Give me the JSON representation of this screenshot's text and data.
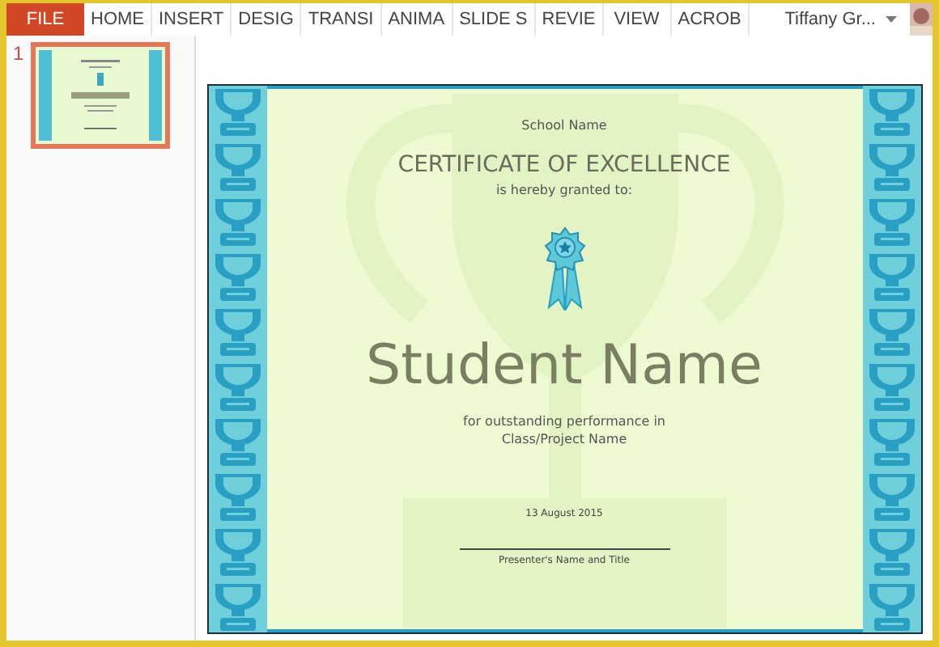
{
  "ribbon": {
    "tabs": [
      {
        "label": "FILE",
        "kind": "file"
      },
      {
        "label": "HOME",
        "kind": "tab"
      },
      {
        "label": "INSERT",
        "kind": "tab"
      },
      {
        "label": "DESIG",
        "kind": "tab"
      },
      {
        "label": "TRANSI",
        "kind": "tab"
      },
      {
        "label": "ANIMA",
        "kind": "tab"
      },
      {
        "label": "SLIDE S",
        "kind": "tab"
      },
      {
        "label": "REVIE",
        "kind": "tab"
      },
      {
        "label": "VIEW",
        "kind": "tab"
      },
      {
        "label": "ACROB",
        "kind": "tab"
      }
    ],
    "user": "Tiffany Gr..."
  },
  "thumbnails": [
    {
      "number": "1",
      "selected": true
    }
  ],
  "slide": {
    "school": "School Name",
    "title": "CERTIFICATE OF EXCELLENCE",
    "granted": "is hereby granted to:",
    "student": "Student Name",
    "reason": "for outstanding performance in",
    "project": "Class/Project Name",
    "date": "13 August 2015",
    "signature_label": "Presenter's Name and Title"
  }
}
